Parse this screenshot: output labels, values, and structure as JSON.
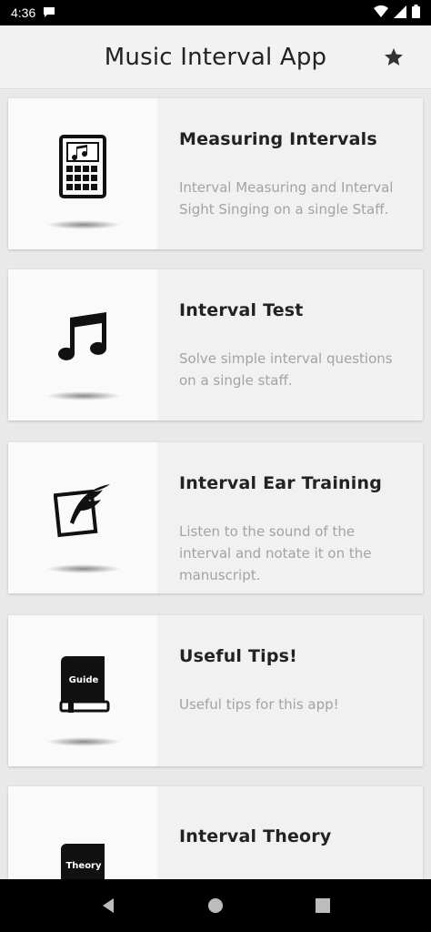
{
  "status_bar": {
    "time": "4:36"
  },
  "app_bar": {
    "title": "Music Interval App",
    "star_icon": "star-icon"
  },
  "cards": [
    {
      "title": "Measuring Intervals",
      "description": "Interval Measuring and Interval Sight Singing on a single Staff.",
      "icon": "calculator-note-icon"
    },
    {
      "title": "Interval Test",
      "description": "Solve simple interval questions on a single staff.",
      "icon": "music-note-icon"
    },
    {
      "title": "Interval Ear Training",
      "description": "Listen to the sound of the interval and notate it on the manuscript.",
      "icon": "quill-paper-icon"
    },
    {
      "title": "Useful Tips!",
      "description": "Useful tips for this app!",
      "icon": "guide-book-icon",
      "badge": "Guide"
    },
    {
      "title": "Interval Theory",
      "description": "",
      "icon": "theory-book-icon",
      "badge": "Theory"
    }
  ],
  "colors": {
    "status_bar": "#000000",
    "app_bar": "#f2f2f2",
    "card": "#f1f1f1",
    "card_media": "#fafafa",
    "desc_text": "#a3a3a3"
  }
}
